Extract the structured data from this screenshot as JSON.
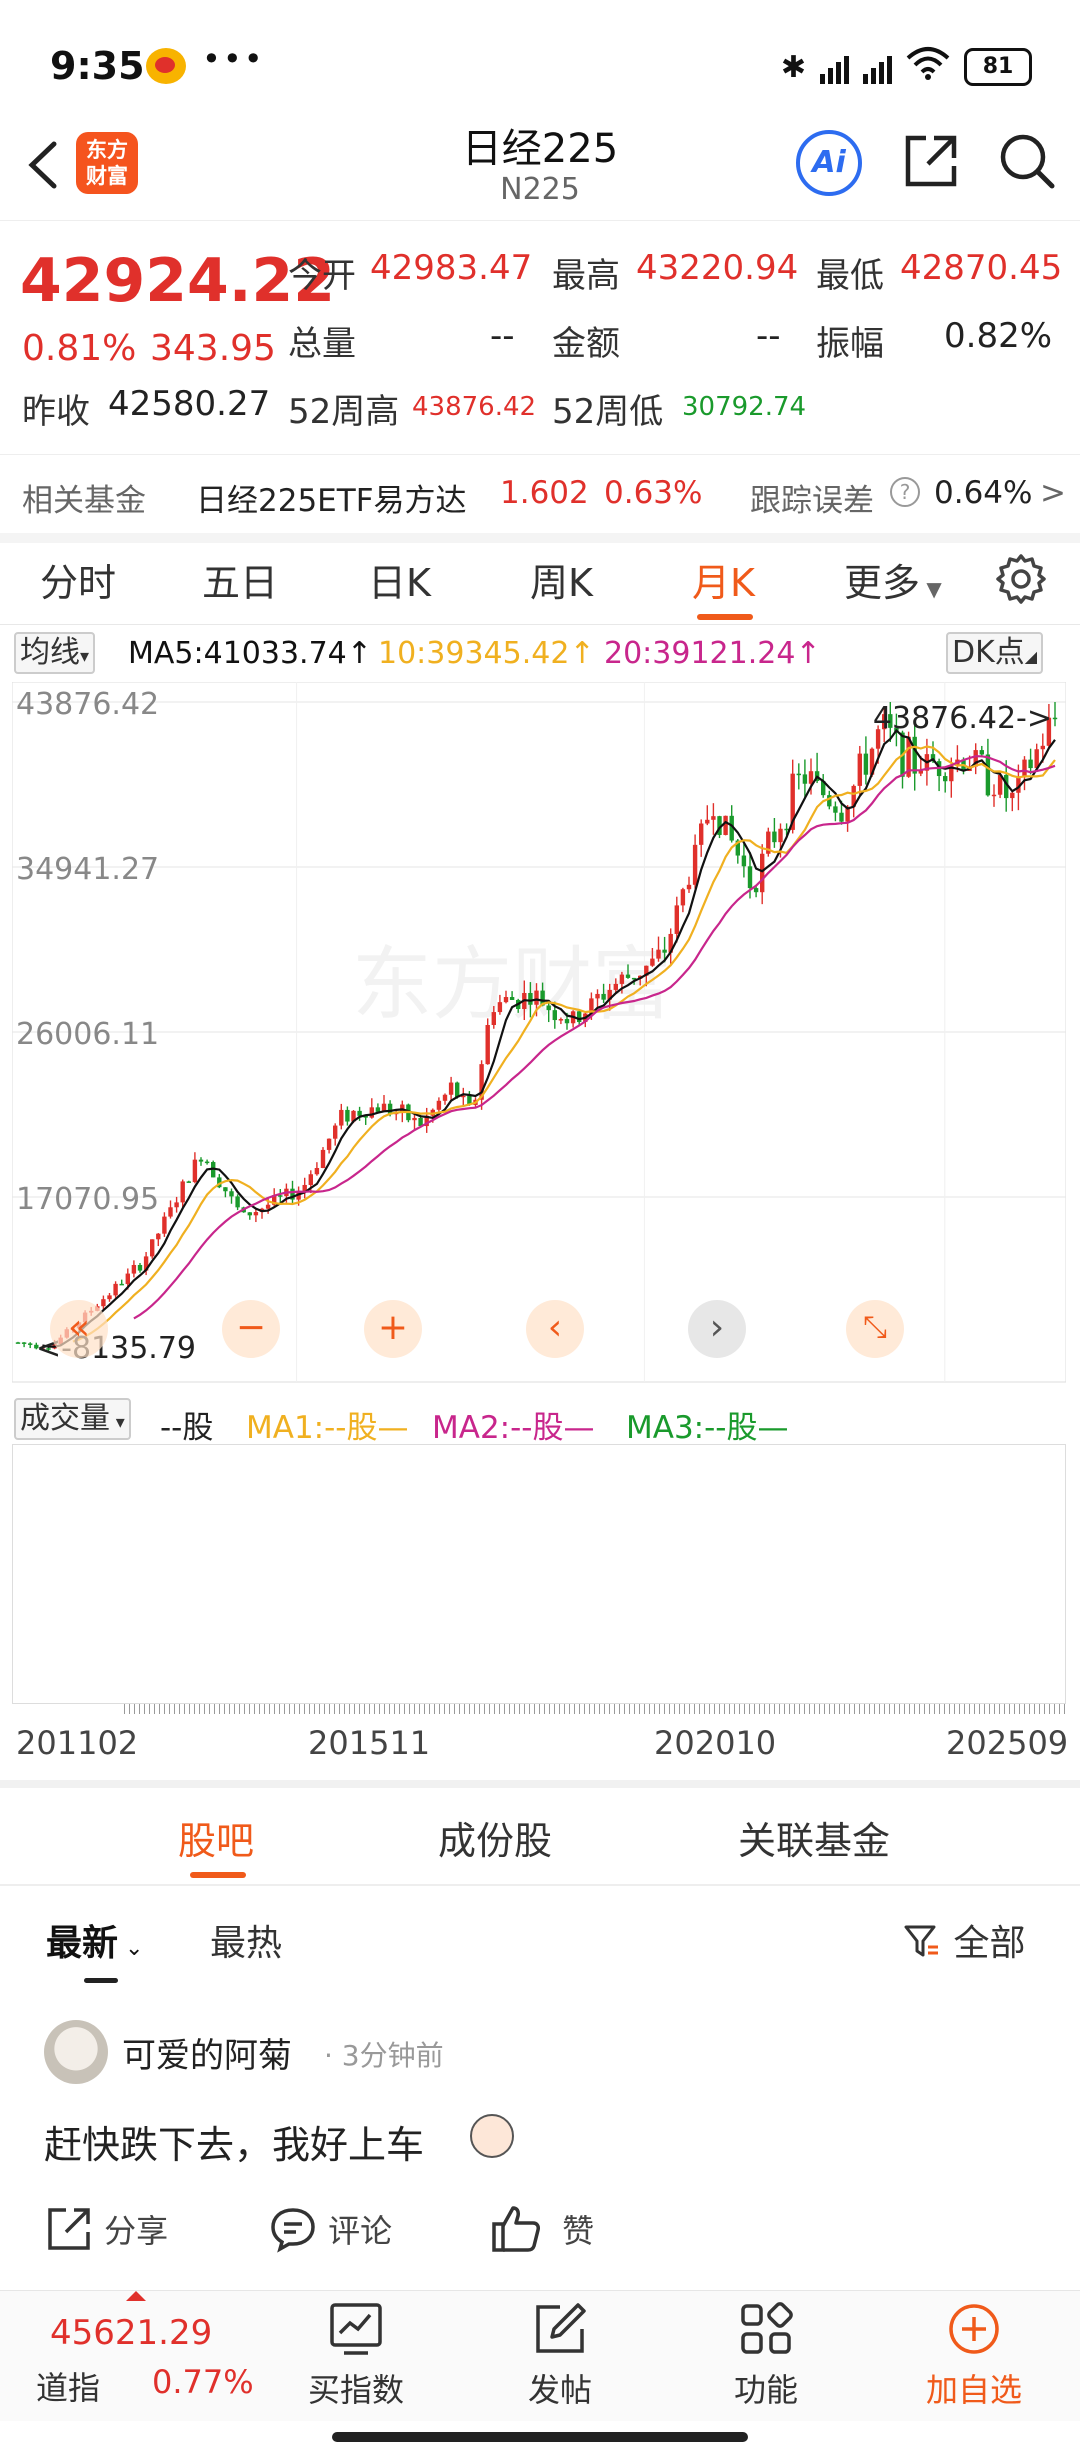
{
  "status": {
    "time": "9:35",
    "battery": "81"
  },
  "header": {
    "title": "日经225",
    "code": "N225",
    "logo_line1": "东方",
    "logo_line2": "财富",
    "ai_label": "Ai"
  },
  "quote": {
    "price": "42924.22",
    "pct": "0.81%",
    "change": "343.95",
    "open_label": "今开",
    "open": "42983.47",
    "high_label": "最高",
    "high": "43220.94",
    "low_label": "最低",
    "low": "42870.45",
    "vol_label": "总量",
    "vol": "--",
    "amt_label": "金额",
    "amt": "--",
    "amp_label": "振幅",
    "amp": "0.82%",
    "prev_label": "昨收",
    "prev": "42580.27",
    "w52h_label": "52周高",
    "w52h": "43876.42",
    "w52l_label": "52周低",
    "w52l": "30792.74"
  },
  "fund": {
    "label": "相关基金",
    "name": "日经225ETF易方达",
    "price": "1.602",
    "pct": "0.63%",
    "track_label": "跟踪误差",
    "track": "0.64%",
    "arrow": ">"
  },
  "ktabs": [
    "分时",
    "五日",
    "日K",
    "周K",
    "月K",
    "更多"
  ],
  "ma": {
    "selector": "均线",
    "ma5": "MA5:41033.74",
    "ma10": "10:39345.42",
    "ma20": "20:39121.24",
    "dk": "DK点"
  },
  "chart_data": {
    "type": "candlestick",
    "y_ticks": [
      "43876.42",
      "34941.27",
      "26006.11",
      "17070.95"
    ],
    "max_label": "43876.42->",
    "min_label": "<-8135.79",
    "x": [
      "201102",
      "201511",
      "202010",
      "202509"
    ],
    "ylim": [
      8135.79,
      43876.42
    ],
    "series": [
      {
        "name": "MA5",
        "color": "#111111"
      },
      {
        "name": "MA10",
        "color": "#f0b020"
      },
      {
        "name": "MA20",
        "color": "#c8268c"
      }
    ],
    "watermark": "东方财富"
  },
  "vol": {
    "selector": "成交量",
    "unit": "--股",
    "ma1": "MA1:--股—",
    "ma2": "MA2:--股—",
    "ma3": "MA3:--股—"
  },
  "ctabs": [
    "股吧",
    "成份股",
    "关联基金"
  ],
  "sort": {
    "latest": "最新",
    "hot": "最热",
    "filter": "全部"
  },
  "post": {
    "user": "可爱的阿菊",
    "time": "· 3分钟前",
    "text": "赶快跌下去，我好上车",
    "share": "分享",
    "comment": "评论",
    "like": "赞"
  },
  "bottom": {
    "dow_value": "45621.29",
    "dow_name": "道指",
    "dow_pct": "0.77%",
    "buy": "买指数",
    "post": "发帖",
    "func": "功能",
    "add": "加自选"
  }
}
